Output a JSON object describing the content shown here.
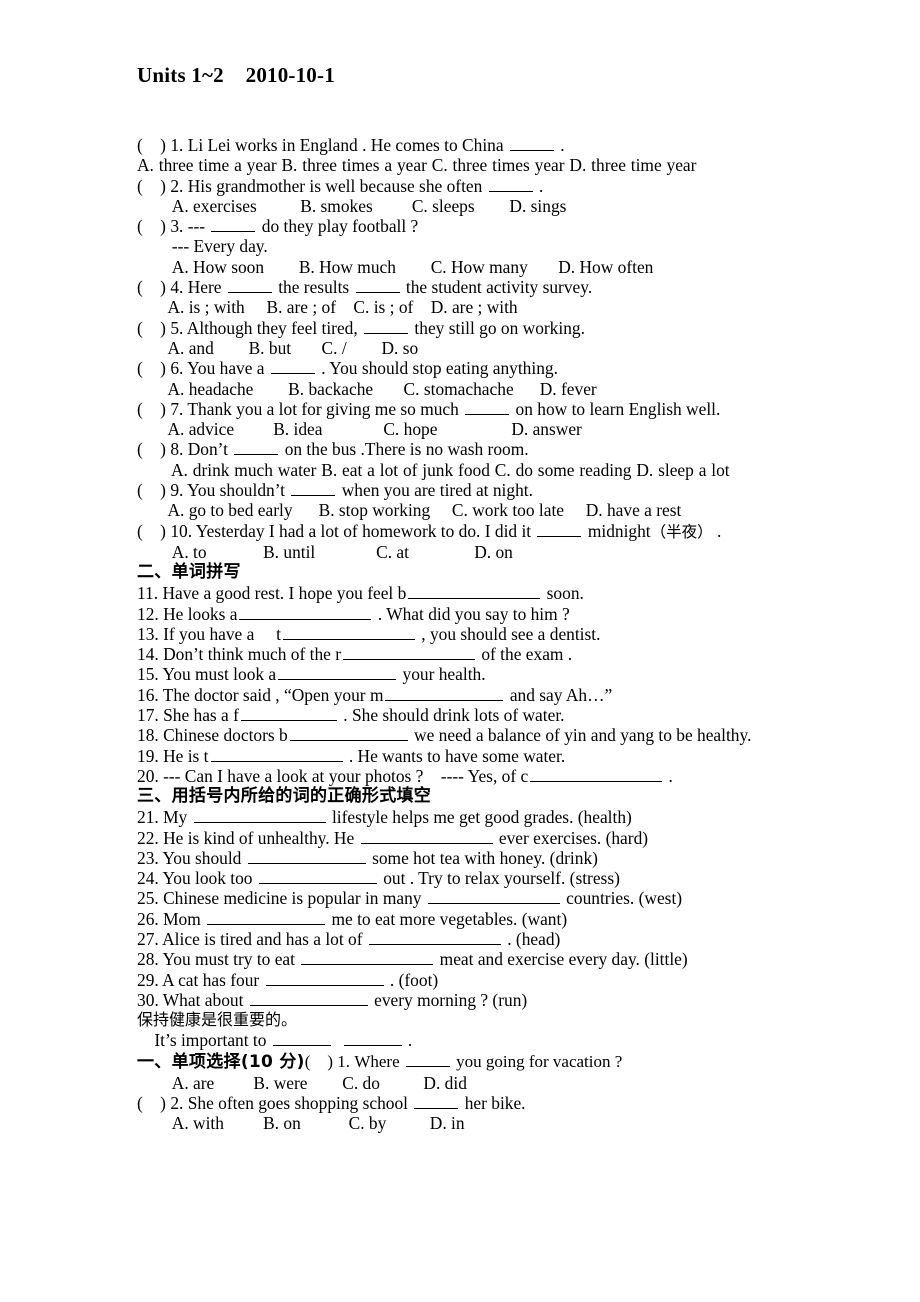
{
  "document": {
    "title": "Units 1~2    2010-10-1"
  },
  "section_choice1": {
    "questions": [
      {
        "marker": "(    ) 1.",
        "stem_before": " Li Lei works in England . He comes to China ",
        "stem_after": " .",
        "options_line": "        A. three time a year    B. three times a year    C. three times year    D. three time year"
      },
      {
        "marker": "(    ) 2.",
        "stem_before": " His grandmother is well because she often ",
        "stem_after": " .",
        "options_line": "        A. exercises          B. smokes         C. sleeps        D. sings"
      },
      {
        "marker": "(    ) 3.",
        "stem_before": " --- ",
        "stem_after": " do they play football ?",
        "extra_line": "        --- Every day.",
        "options_line": "        A. How soon        B. How much        C. How many       D. How often"
      },
      {
        "marker": "(    ) 4.",
        "stem_before": " Here ",
        "stem_mid": " the results ",
        "stem_after": " the student activity survey.",
        "options_line": "       A. is ; with     B. are ; of    C. is ; of    D. are ; with"
      },
      {
        "marker": "(    ) 5.",
        "stem_before": " Although they feel tired, ",
        "stem_after": " they still go on working.",
        "options_line": "       A. and        B. but       C. /        D. so"
      },
      {
        "marker": "(    ) 6.",
        "stem_before": " You have a ",
        "stem_after": " . You should stop eating anything.",
        "options_line": "       A. headache        B. backache       C. stomachache      D. fever"
      },
      {
        "marker": "(    ) 7.",
        "stem_before": " Thank you a lot for giving me so much ",
        "stem_after": " on how to learn English well.",
        "options_line": "       A. advice         B. idea              C. hope                 D. answer"
      },
      {
        "marker": "(    ) 8.",
        "stem_before": " Don’t ",
        "stem_after": " on the bus .There is no wash room.",
        "options_line": "A. drink much water     B. eat a lot of junk food     C. do some    reading D. sleep a lot"
      },
      {
        "marker": "(    ) 9.",
        "stem_before": " You shouldn’t ",
        "stem_after": " when you are tired at night.",
        "options_line": "       A. go to bed early      B. stop working     C. work too late     D. have a rest"
      },
      {
        "marker": "(    ) 10.",
        "stem_before": " Yesterday I had a lot of homework to do. I did it ",
        "stem_after": " midnight",
        "stem_cn": "（半夜）",
        "stem_end": " .",
        "options_line": "        A. to             B. until              C. at               D. on"
      }
    ]
  },
  "section_spelling": {
    "heading": "二、单词拼写",
    "items": [
      {
        "before": "11. Have a good rest. I hope you feel b",
        "after": " soon."
      },
      {
        "before": "12. He looks a",
        "after": " . What did you say to him ?"
      },
      {
        "before": "13. If you have a     t",
        "after": " , you should see a dentist."
      },
      {
        "before": "14. Don’t think much of the r",
        "after": " of the exam ."
      },
      {
        "before": "15. You must look a",
        "after": " your health."
      },
      {
        "before": "16. The doctor said , “Open your m",
        "after": " and say Ah…”"
      },
      {
        "before": "17. She has a f",
        "after": " . She should drink lots of water."
      },
      {
        "before": "18.  Chinese  doctors  b",
        "after": "  we  need  a  balance  of  yin  and  yang  to  be healthy."
      },
      {
        "before": "19. He is t",
        "after": " . He wants to have some water."
      },
      {
        "before": "20. --- Can I have a look at your photos ?    ---- Yes, of c",
        "after": " ."
      }
    ]
  },
  "section_forms": {
    "heading": "三、用括号内所给的词的正确形式填空",
    "items": [
      {
        "before": "21. My ",
        "after": " lifestyle helps me get good grades. (health)"
      },
      {
        "before": "22. He is kind of unhealthy. He ",
        "after": " ever exercises. (hard)"
      },
      {
        "before": "23. You should ",
        "after": " some hot tea with honey. (drink)"
      },
      {
        "before": "24. You look too ",
        "after": " out . Try to relax yourself. (stress)"
      },
      {
        "before": "25. Chinese medicine is popular in many ",
        "after": " countries. (west)"
      },
      {
        "before": "26. Mom ",
        "after": " me to eat more vegetables. (want)"
      },
      {
        "before": "27. Alice is tired and has a lot of ",
        "after": " . (head)"
      },
      {
        "before": "28. You must try to eat ",
        "after": " meat and exercise every day. (little)"
      },
      {
        "before": "29. A cat has four ",
        "after": " . (foot)"
      },
      {
        "before": "30. What about ",
        "after": " every morning ? (run)"
      }
    ],
    "cn_prompt": "保持健康是很重要的。",
    "translation_before": "    It’s important to ",
    "translation_after": " ."
  },
  "section_choice2": {
    "heading_cn": "一、单项选择",
    "heading_score": "(10 分)",
    "first_marker": "(    ) 1.",
    "first_stem_before": " Where ",
    "first_stem_after": " you going for vacation ?",
    "first_options": "        A. are         B. were        C. do          D. did",
    "questions": [
      {
        "marker": "(    ) 2.",
        "stem_before": " She often goes shopping school ",
        "stem_after": " her bike.",
        "options_line": "        A. with         B. on           C. by          D. in"
      }
    ]
  }
}
